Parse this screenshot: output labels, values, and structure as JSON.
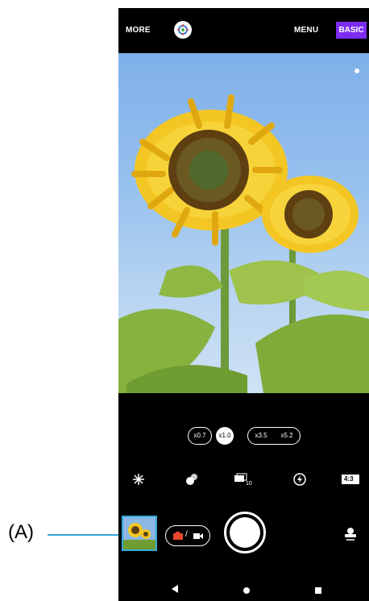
{
  "callout": {
    "label": "(A)"
  },
  "top_bar": {
    "more_label": "MORE",
    "menu_label": "MENU",
    "basic_label": "BASIC"
  },
  "zoom": {
    "options": [
      "x0.7",
      "x1.0",
      "x3.5",
      "x5.2"
    ],
    "selected": "x1.0"
  },
  "tools": [
    "flash-icon",
    "bokeh-icon",
    "burst-icon",
    "hdr-icon",
    "aspect-ratio-icon"
  ],
  "aspect_ratio_label": "4:3",
  "mode_toggle": {
    "label": "/"
  },
  "colors": {
    "accent": "#7b2cf0",
    "callout": "#37a8d8",
    "record": "#e8482c"
  }
}
